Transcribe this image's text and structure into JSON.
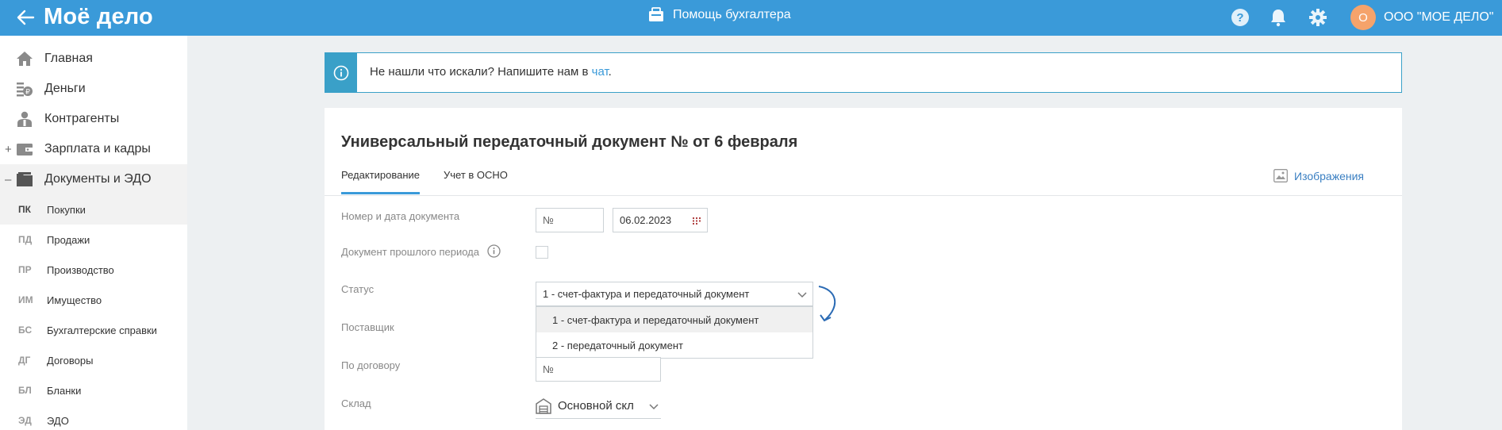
{
  "topbar": {
    "logo": "Моё дело",
    "helper_label": "Помощь бухгалтера",
    "org_initial": "О",
    "org_name": "ООО \"МОЕ ДЕЛО\"",
    "accent": "#3a9ad9"
  },
  "sidebar": {
    "items": [
      {
        "label": "Главная",
        "icon": "home-icon"
      },
      {
        "label": "Деньги",
        "icon": "money-icon"
      },
      {
        "label": "Контрагенты",
        "icon": "contractors-icon"
      },
      {
        "label": "Зарплата и кадры",
        "icon": "salary-icon",
        "toggle": "+"
      },
      {
        "label": "Документы и ЭДО",
        "icon": "folder-icon",
        "toggle": "–"
      }
    ],
    "subitems": [
      {
        "code": "ПК",
        "label": "Покупки"
      },
      {
        "code": "ПД",
        "label": "Продажи"
      },
      {
        "code": "ПР",
        "label": "Производство"
      },
      {
        "code": "ИМ",
        "label": "Имущество"
      },
      {
        "code": "БС",
        "label": "Бухгалтерские справки"
      },
      {
        "code": "ДГ",
        "label": "Договоры"
      },
      {
        "code": "БЛ",
        "label": "Бланки"
      },
      {
        "code": "ЭД",
        "label": "ЭДО"
      }
    ]
  },
  "banner": {
    "text": "Не нашли что искали? Напишите нам в ",
    "link": "чат",
    "end": "."
  },
  "document": {
    "title": "Универсальный передаточный документ № от 6 февраля",
    "tabs": [
      "Редактирование",
      "Учет в ОСНО"
    ],
    "images_label": "Изображения",
    "labels": {
      "number_date": "Номер и дата документа",
      "past_period": "Документ прошлого периода",
      "status": "Статус",
      "supplier": "Поставщик",
      "contract": "По договору",
      "warehouse": "Склад"
    },
    "number_placeholder": "№",
    "date_value": "06.02.2023",
    "status_value": "1 - счет-фактура и передаточный документ",
    "status_options": [
      "1 - счет-фактура и передаточный документ",
      "2 - передаточный документ"
    ],
    "contract_placeholder": "№",
    "warehouse_value": "Основной скл"
  }
}
